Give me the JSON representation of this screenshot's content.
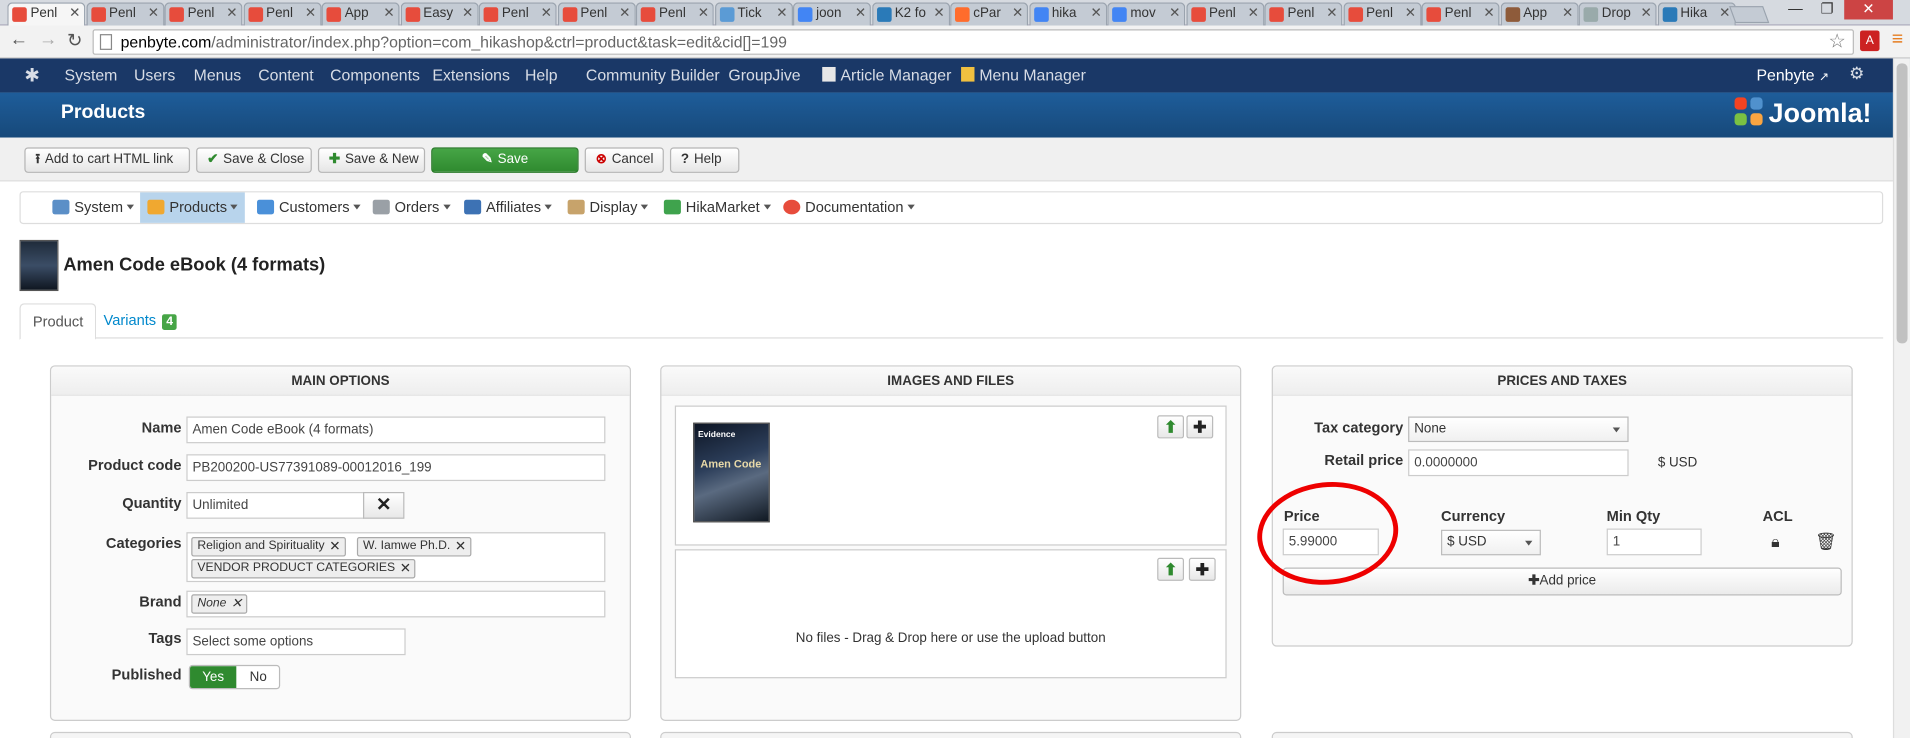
{
  "browser": {
    "tabs": [
      {
        "label": "Penl",
        "color": "#e74c3c"
      },
      {
        "label": "Penl",
        "color": "#e74c3c"
      },
      {
        "label": "Penl",
        "color": "#e74c3c"
      },
      {
        "label": "Penl",
        "color": "#e74c3c"
      },
      {
        "label": "App",
        "color": "#e74c3c"
      },
      {
        "label": "Easy",
        "color": "#e74c3c"
      },
      {
        "label": "Penl",
        "color": "#e74c3c"
      },
      {
        "label": "Penl",
        "color": "#e74c3c"
      },
      {
        "label": "Penl",
        "color": "#e74c3c"
      },
      {
        "label": "Tick",
        "color": "#5b9bd5"
      },
      {
        "label": "joon",
        "color": "#4285f4"
      },
      {
        "label": "K2 fo",
        "color": "#2a7ab8"
      },
      {
        "label": "cPar",
        "color": "#ff6c2c"
      },
      {
        "label": "hika",
        "color": "#4285f4"
      },
      {
        "label": "mov",
        "color": "#4285f4"
      },
      {
        "label": "Penl",
        "color": "#e74c3c"
      },
      {
        "label": "Penl",
        "color": "#e74c3c"
      },
      {
        "label": "Penl",
        "color": "#e74c3c"
      },
      {
        "label": "Penl",
        "color": "#e74c3c"
      },
      {
        "label": "App",
        "color": "#8e5b3a"
      },
      {
        "label": "Drop",
        "color": "#9aa"
      },
      {
        "label": "Hika",
        "color": "#2a7ab8"
      }
    ],
    "url_host": "penbyte.com",
    "url_path": "/administrator/index.php?option=com_hikashop&ctrl=product&task=edit&cid[]=199"
  },
  "topnav": {
    "items": [
      "System",
      "Users",
      "Menus",
      "Content",
      "Components",
      "Extensions",
      "Help",
      "Community Builder",
      "GroupJive",
      "Article Manager",
      "Menu Manager"
    ],
    "site_name": "Penbyte"
  },
  "title": "Products",
  "brand": "Joomla!",
  "toolbar": {
    "add_to_cart": "Add to cart HTML link",
    "save_close": "Save & Close",
    "save_new": "Save & New",
    "save": "Save",
    "cancel": "Cancel",
    "help": "Help"
  },
  "hikamenu": {
    "items": [
      "System",
      "Products",
      "Customers",
      "Orders",
      "Affiliates",
      "Display",
      "HikaMarket",
      "Documentation"
    ]
  },
  "product": {
    "title": "Amen Code eBook (4 formats)",
    "tabs": {
      "product": "Product",
      "variants": "Variants",
      "variants_count": "4"
    }
  },
  "main_options": {
    "heading": "MAIN OPTIONS",
    "name_label": "Name",
    "name_value": "Amen Code eBook (4 formats)",
    "code_label": "Product code",
    "code_value": "PB200200-US77391089-00012016_199",
    "quantity_label": "Quantity",
    "quantity_value": "Unlimited",
    "categories_label": "Categories",
    "categories": [
      "Religion and Spirituality",
      "W. Iamwe Ph.D.",
      "VENDOR PRODUCT CATEGORIES"
    ],
    "brand_label": "Brand",
    "brand_value": "None",
    "tags_label": "Tags",
    "tags_placeholder": "Select some options",
    "published_label": "Published",
    "yes": "Yes",
    "no": "No"
  },
  "images_files": {
    "heading": "IMAGES AND FILES",
    "cover_title": "Evidence",
    "cover_name": "Amen Code",
    "no_files": "No files - Drag & Drop here or use the upload button"
  },
  "prices": {
    "heading": "PRICES AND TAXES",
    "tax_label": "Tax category",
    "tax_value": "None",
    "retail_label": "Retail price",
    "retail_value": "0.0000000",
    "retail_currency": "$ USD",
    "price_label": "Price",
    "price_value": "5.99000",
    "currency_label": "Currency",
    "currency_value": "$ USD",
    "minqty_label": "Min Qty",
    "minqty_value": "1",
    "acl_label": "ACL",
    "add_price": "Add price"
  }
}
